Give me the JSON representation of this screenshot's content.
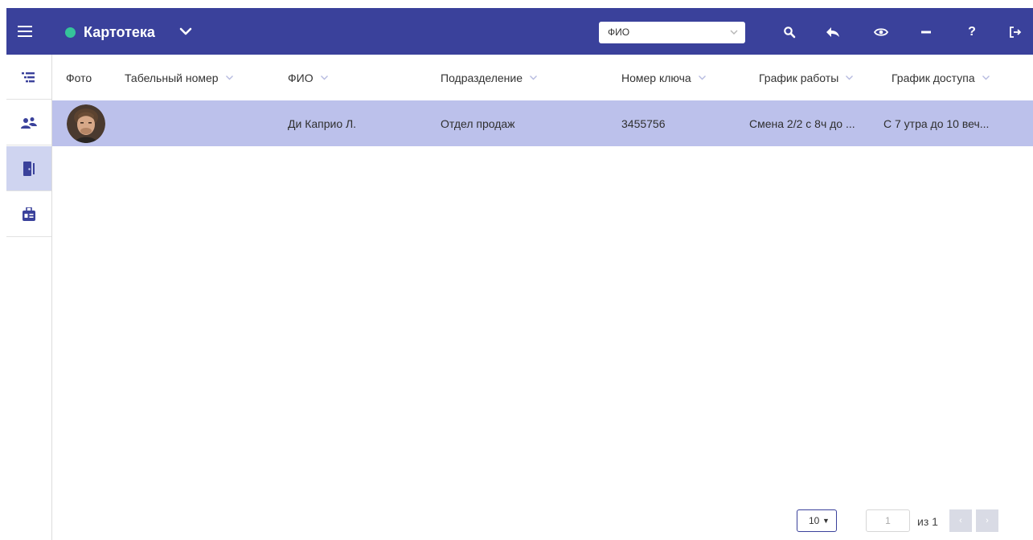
{
  "app": {
    "title": "Картотека",
    "status_color": "#35c49a",
    "accent": "#3a419b",
    "selected_row_color": "#bcc1eb"
  },
  "toolbar": {
    "search_field": {
      "value": "ФИО"
    },
    "help_label": "?",
    "icons": [
      "menu-icon",
      "chevron-down-icon",
      "search-icon",
      "reply-icon",
      "eye-icon",
      "minus-icon",
      "help-icon",
      "logout-icon"
    ]
  },
  "sidebar": {
    "items": [
      {
        "name": "list-icon"
      },
      {
        "name": "users-icon"
      },
      {
        "name": "door-icon",
        "active": true
      },
      {
        "name": "id-badge-icon"
      }
    ]
  },
  "table": {
    "columns": [
      "Фото",
      "Табельный номер",
      "ФИО",
      "Подразделение",
      "Номер ключа",
      "График работы",
      "График доступа"
    ],
    "rows": [
      {
        "photo": "avatar",
        "tab_number": "",
        "fio": "Ди Каприо Л.",
        "department": "Отдел продаж",
        "key_number": "3455756",
        "work_schedule": "Смена 2/2 с 8ч до ...",
        "access_schedule": "С 7 утра до 10 веч..."
      }
    ]
  },
  "pagination": {
    "page_size": "10",
    "page_size_arrow": "▼",
    "current_page": "1",
    "of_label": "из 1",
    "prev": "‹",
    "next": "›"
  }
}
